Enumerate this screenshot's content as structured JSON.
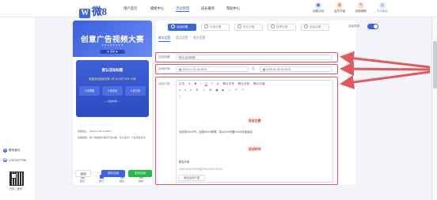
{
  "brand": {
    "logo_glyph": "W",
    "logo_text": "微8"
  },
  "nav": [
    "用户首页",
    "模板中心",
    "活动管理",
    "成长服务",
    "帮助中心"
  ],
  "nav_active_index": 2,
  "top_icons": [
    {
      "label": "创建活动",
      "glyph": "◉"
    },
    {
      "label": "会员升级",
      "glyph": "♛"
    },
    {
      "label": "续费通知",
      "glyph": "✎"
    },
    {
      "label": "个人中心",
      "glyph": "☺"
    }
  ],
  "sidebar": {
    "contact_label": "联系我们",
    "phone": "17671277790",
    "qr_caption": "扫码二维码"
  },
  "preview": {
    "banner_title": "创意广告视频大赛",
    "banner_sub": "★ ★ ★ ★ ★ ★ ★ ★",
    "banner_pill": "★ 活动 ★",
    "card_title": "默认活动标题",
    "countdown": "距离活动结束还有 1天 20小时 42分 22秒",
    "stats": [
      {
        "value": "0",
        "label": "总票数"
      },
      {
        "value": "0",
        "label": "总访问"
      },
      {
        "value": "0",
        "label": "总分享"
      }
    ],
    "rules_heading": "— 活动时间 —",
    "rules": [
      "投票开始：2024-12-31 16:28:31",
      "投票截止：2025-01-06 16:28:31",
      "投票规则：每个微信用户每天可投3票，可以给同一个选手投多次"
    ],
    "tabbar": [
      "首页",
      "排行",
      "报名",
      "我的"
    ],
    "tab_active_index": 1,
    "buttons": [
      {
        "label": "返回",
        "bg": "#ffffff",
        "fg": "#333333"
      },
      {
        "label": "保存活动",
        "bg": "#3b63e6",
        "fg": "#ffffff"
      },
      {
        "label": "发布活动",
        "bg": "#28b84a",
        "fg": "#ffffff"
      }
    ]
  },
  "steps": [
    "活动设置",
    "页面设置",
    "报名设置",
    "投票设置",
    "高级设置"
  ],
  "publish_label": "活动发布",
  "subtabs": [
    "基本设置",
    "奖品设置",
    "其它设置"
  ],
  "form": {
    "title_label": "活动标题",
    "title_value": "默认活动标题",
    "time_label": "活动时间",
    "start": "2024-12-31 16:28:31",
    "end": "2025-01-06 16:28:31",
    "intro_label": "活动介绍",
    "toolbar_row1": [
      "正文",
      "A",
      "B",
      "I",
      "U",
      "T",
      "A",
      "默认字号",
      "默认字体",
      "默认行高"
    ],
    "toolbar_row2": [
      "≡",
      "≡",
      "≡",
      "☰",
      "☺",
      "⊞",
      "▣",
      "▶",
      "⇔",
      "↶",
      "↷"
    ],
    "section1_title": "活动主题",
    "body_prefix": "为庆祝XXXX节，弘扬XXXX精神，将以XXX开展XXXX评选活动。",
    "section2_title": "活动时间",
    "time_caption": "报名时间",
    "time_line": "2024.05.10 09:00至2024.05.20 18:00",
    "add_button": "添加活动介绍"
  },
  "colors": {
    "accent": "#3b63e6",
    "highlight": "#e35a5d",
    "success": "#28b84a"
  }
}
